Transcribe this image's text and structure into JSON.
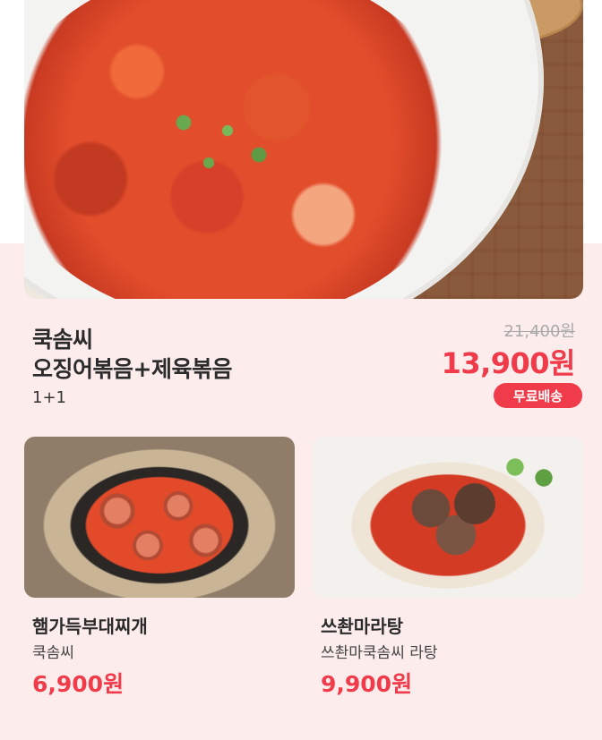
{
  "featured": {
    "title_line1": "쿡솜씨",
    "title_line2": "오징어볶음+제육볶음",
    "subtitle": "1+1",
    "original_price": "21,400원",
    "sale_price": "13,900원",
    "badge": "무료배송"
  },
  "products": [
    {
      "title": "햄가득부대찌개",
      "subtitle": "쿡솜씨",
      "price": "6,900원"
    },
    {
      "title": "쓰촨마라탕",
      "subtitle": "쓰촨마쿡솜씨 라탕",
      "price": "9,900원"
    }
  ],
  "colors": {
    "accent": "#ef3b4a",
    "background_pink": "#fdecec",
    "text_dark": "#2b2b2b",
    "strike_gray": "#a9a9a9"
  }
}
